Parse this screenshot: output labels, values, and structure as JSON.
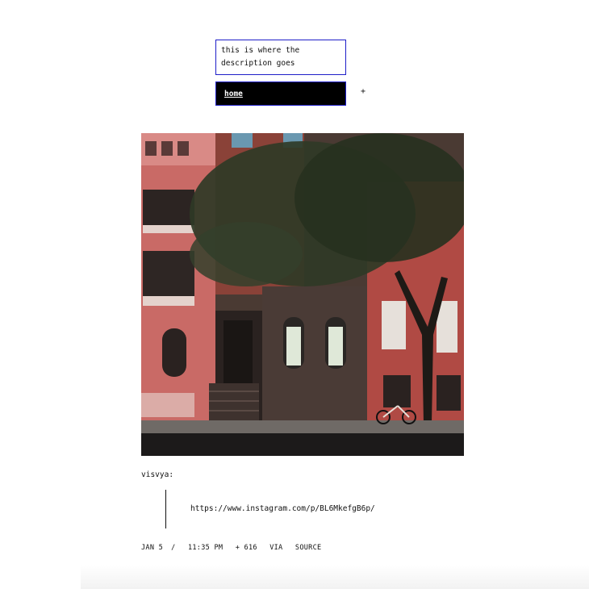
{
  "header": {
    "description": "this is where the description goes",
    "nav_home_label": "home",
    "toggle_symbol": "+"
  },
  "post": {
    "author": "visvya:",
    "quote_link_text": "https://www.instagram.com/p/BL6MkefgB6p/",
    "meta": {
      "date": "JAN 5",
      "separator": "/",
      "time": "11:35 PM",
      "notes": "+ 616",
      "via_label": "VIA",
      "source_label": "SOURCE"
    }
  },
  "colors": {
    "accent_border": "#1e1ec8",
    "nav_background": "#000000"
  }
}
